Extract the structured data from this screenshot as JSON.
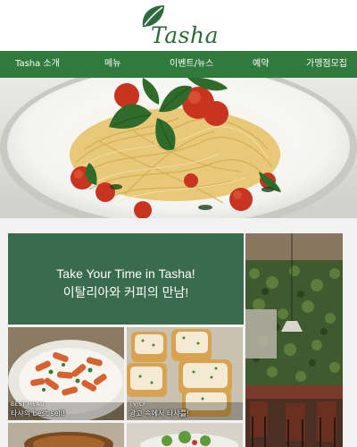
{
  "brand": {
    "name": "Tasha",
    "color": "#2d6a3c"
  },
  "nav": {
    "background": "#2f7a3c",
    "items": [
      {
        "label": "Tasha 소개"
      },
      {
        "label": "메뉴"
      },
      {
        "label": "이벤트/뉴스"
      },
      {
        "label": "예약"
      },
      {
        "label": "가맹점모집"
      }
    ]
  },
  "hero": {
    "icon": "pasta-photo"
  },
  "banner": {
    "line1": "Take Your Time in Tasha!",
    "line2": "이탈리아와 커피의 만남!",
    "background": "#3b6b4d"
  },
  "tiles": {
    "best_menu": {
      "tag": "BEST MENU",
      "caption": "타샤의 best sell!"
    },
    "tvcf": {
      "tag": "TV/CF",
      "caption": "광고 속에서 타샤를!"
    }
  }
}
